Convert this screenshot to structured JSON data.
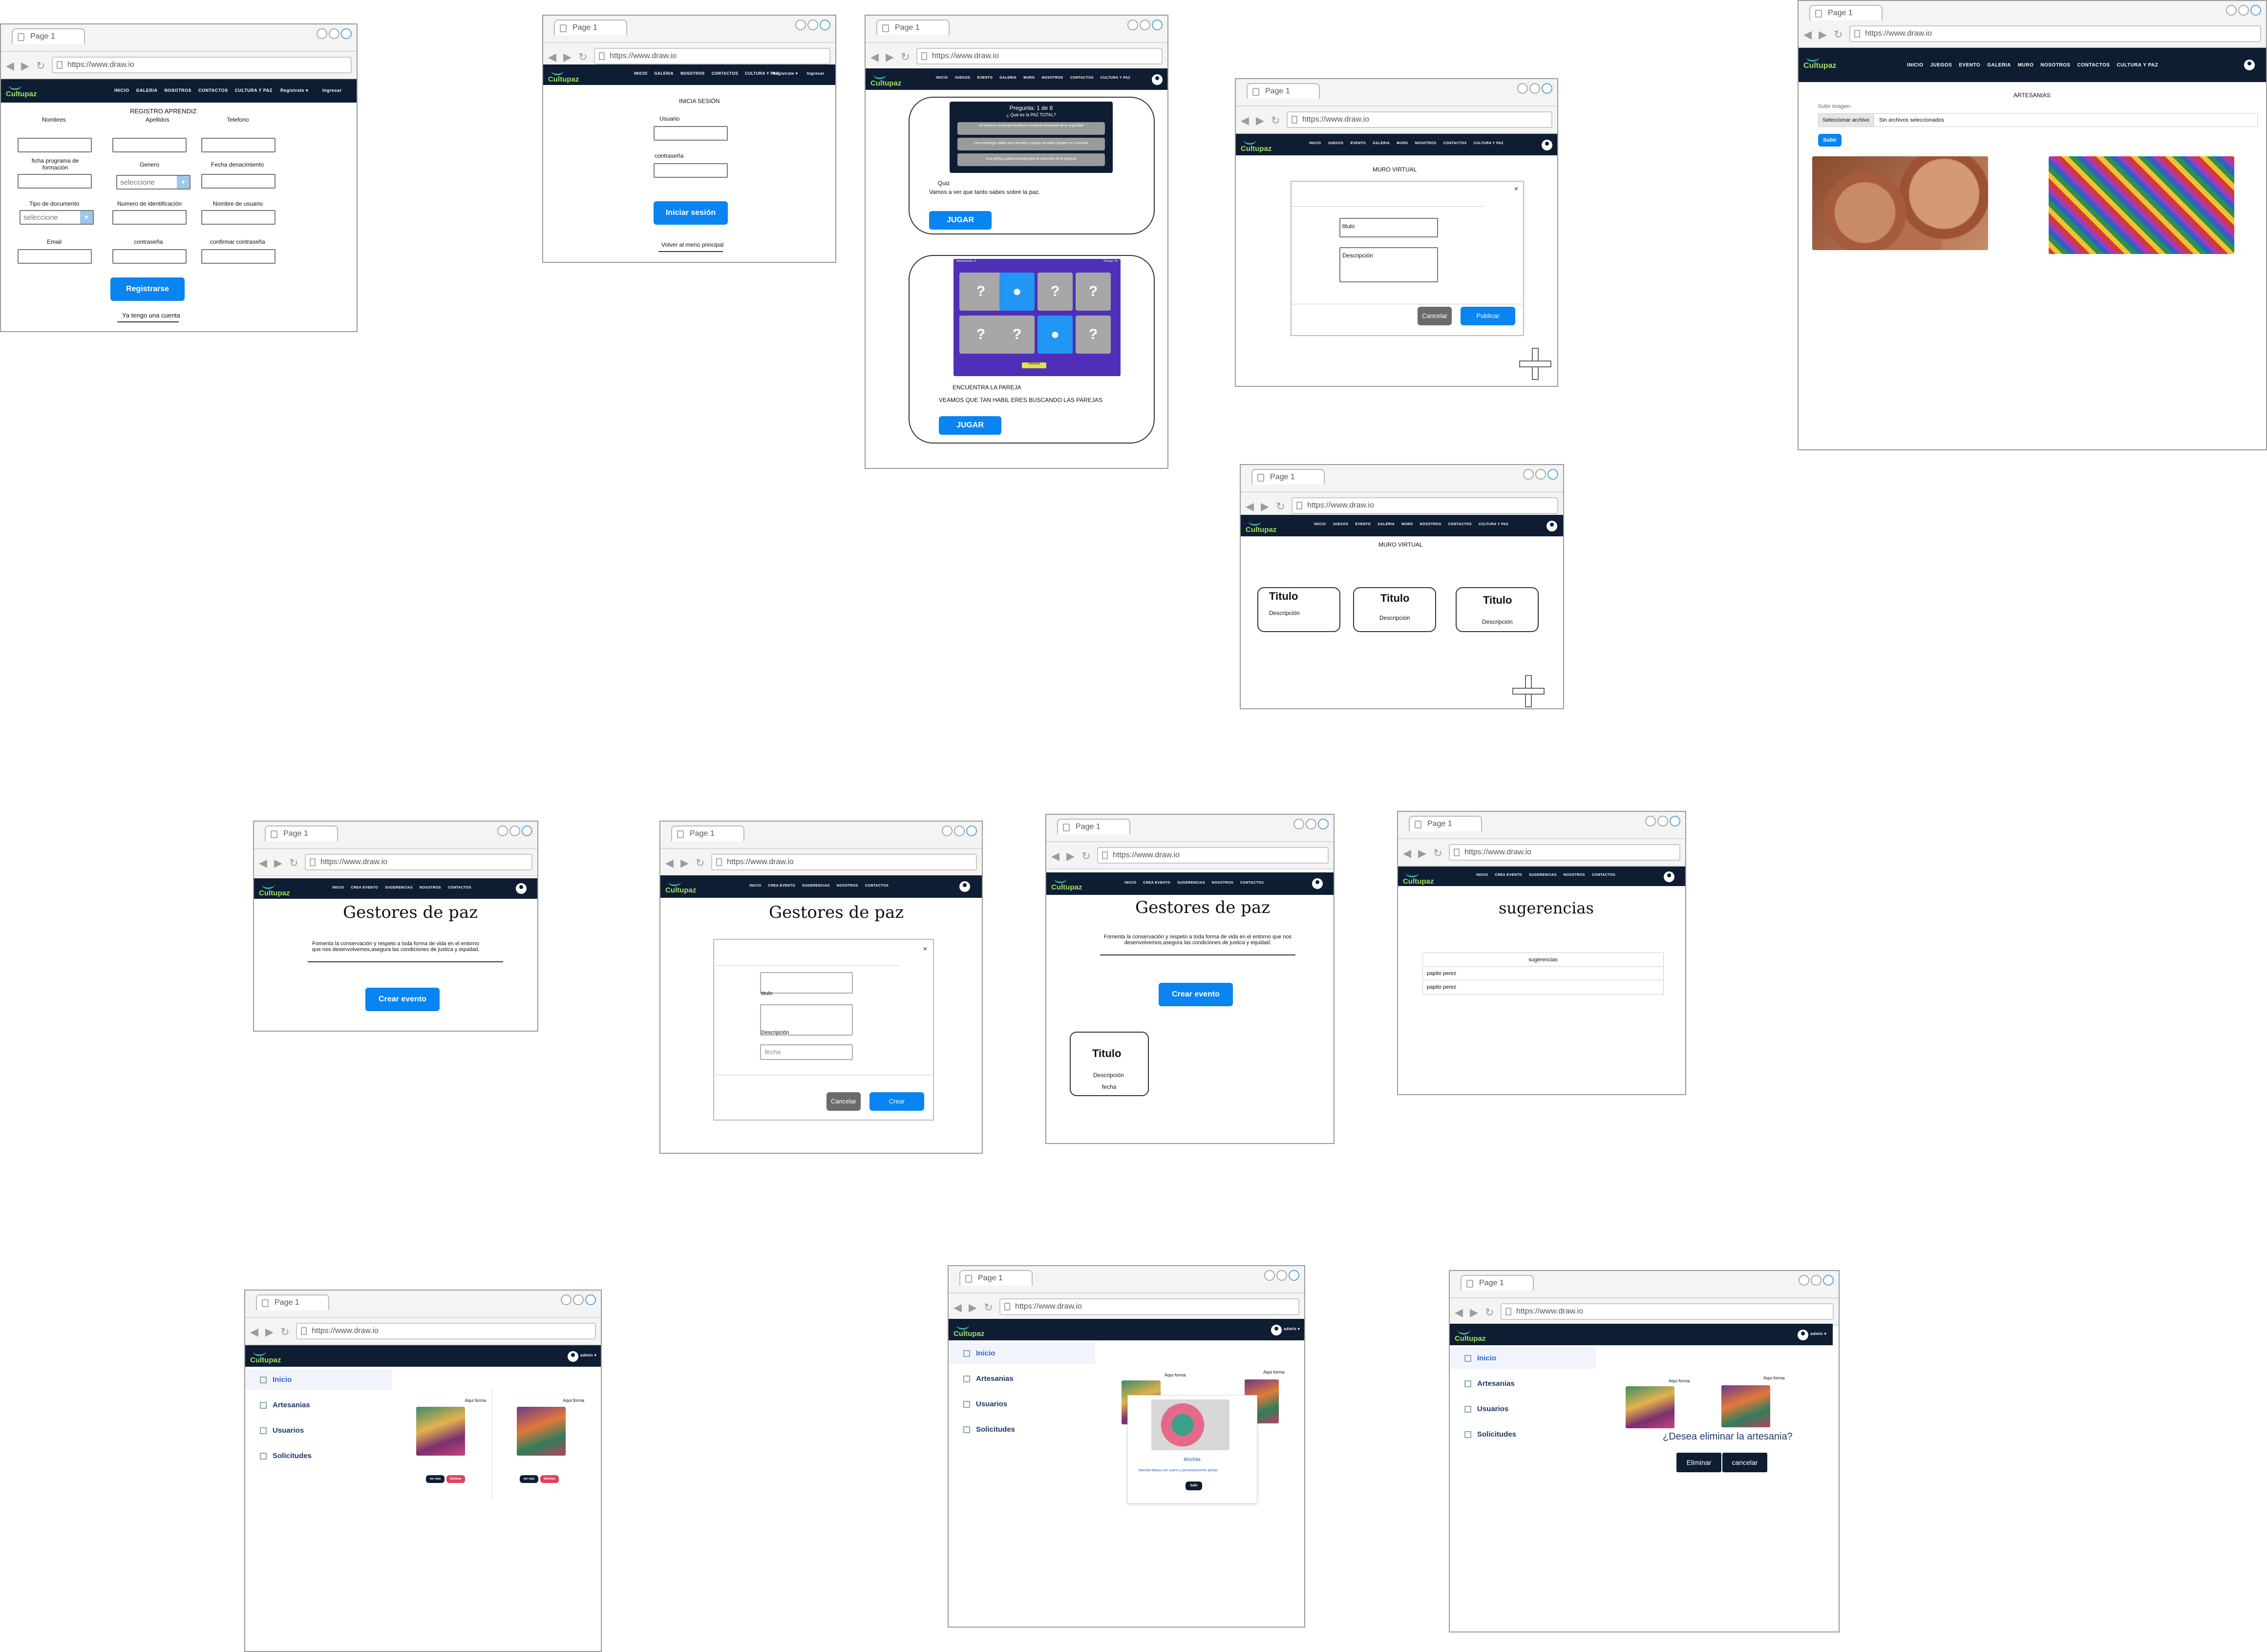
{
  "browser": {
    "tab_label": "Page 1",
    "url": "https://www.draw.io",
    "url_alt": "https://www.draw.io "
  },
  "brand": {
    "logo": "Cultupaz",
    "colors": {
      "nav": "#0f1d33",
      "primary": "#0a84f0",
      "logo": "#9be05c"
    }
  },
  "nav_public": [
    "INICIO",
    "GALERIA",
    "NOSOTROS",
    "CONTACTOS",
    "CULTURA Y PAZ"
  ],
  "nav_register": "Registrate ▾",
  "nav_login": "Ingresar",
  "nav_games": [
    "INICIO",
    "JUEGOS",
    "EVENTO",
    "GALERIA",
    "MURO",
    "NOSOTROS",
    "CONTACTOS",
    "CULTURA Y PAZ"
  ],
  "nav_gestores": [
    "INICIO",
    "CREA EVENTO",
    "SUGERENCIAS",
    "NOSOTROS",
    "CONTACTOS"
  ],
  "register": {
    "title": "REGISTRO APRENDIZ",
    "labels": [
      "Nombres",
      "Apellidos",
      "Telefono",
      "ficha programa de formación",
      "Genero",
      "Fecha denacimiento",
      "Tipo de documento",
      "Numero de identificación",
      "Nombre de usuario",
      "Email",
      "contraseña",
      "confirmar contraseña"
    ],
    "select_placeholder": "seleccione",
    "submit": "Registrarse",
    "have_account": "Ya tengo una cuenta"
  },
  "login": {
    "title": "INICIA SESIÓN",
    "user_label": "Usuario",
    "pass_label": "contraseña",
    "submit": "Iniciar sesión",
    "back": "Volver al menú principal"
  },
  "games": {
    "quiz_question_header": "Pregunta: 1 de 8",
    "quiz_question": "¿ Qué es la PAZ TOTAL?",
    "quiz_options": [
      "Un proceso social que facilita la constante búsqueda de la seguridad",
      "Una estrategia militar para derrotar a grupos armados ilegales en Colombia",
      "Una política gubernamental para la reducción de la pobreza"
    ],
    "quiz_caption": "Quiz",
    "quiz_desc": "Vamos a ver que tanto sabes sobre la paz.",
    "play": "JUGAR",
    "memory_title": "ENCUENTRA LA PAREJA",
    "memory_desc": "VEAMOS QUE TAN HABIL ERES BUSCANDO LAS PAREJAS",
    "memory_cards": [
      "?",
      "●",
      "?",
      "?",
      "?",
      "?",
      "●",
      "?"
    ],
    "memory_header_left": "Movimientos: 0",
    "memory_header_right": "Tiempo: 0s",
    "memory_reset": "Reiniciar"
  },
  "muro": {
    "title": "MURO VIRTUAL",
    "close": "×",
    "titulo_placeholder": "titulo",
    "descripcion_placeholder": "Descripción",
    "cancel": "Cancelar",
    "publish": "Publicar",
    "cards": [
      {
        "title": "Titulo",
        "desc": "Descripción"
      },
      {
        "title": "Titulo",
        "desc": "Descripción"
      },
      {
        "title": "Titulo",
        "desc": "Descripción"
      }
    ]
  },
  "artesanias": {
    "title": "ARTESANIAS",
    "upload_label": "Subir imagen:",
    "choose_file": "Seleccionar archivo",
    "no_file": "Sin archivos seleccionados",
    "submit": "Subir"
  },
  "gestores": {
    "title": "Gestores de paz",
    "desc": "Fomenta la conservación y respeto a toda forma de vida en el entorno que nos desenvolvemos,asegura las condiciones de justica y equidad.",
    "create": "Crear evento",
    "form_titulo": "titulo",
    "form_desc": "Descripción",
    "form_fecha": "fecha",
    "form_cancel": "Cancelar",
    "form_create": "Crear",
    "event_card": {
      "title": "Titulo",
      "desc": "Descripción",
      "date": "fecha"
    }
  },
  "sugerencias": {
    "title": "sugerencias",
    "header": "sugerencias",
    "rows": [
      "papito perez",
      "papito perez"
    ]
  },
  "admin": {
    "user": "admin ▾",
    "menu": [
      "Inicio",
      "Artesanias",
      "Usuarios",
      "Solicitudes"
    ],
    "items": [
      {
        "name": "Aqui forma",
        "view": "ver más",
        "delete": "Eliminar"
      },
      {
        "name": "Aqui forma",
        "view": "ver más",
        "delete": "Eliminar"
      }
    ],
    "detail_name": "Mochila",
    "detail_desc": "Mochila Wayuu con sueno y personas/correo piezas",
    "detail_close": "Salir",
    "delete_question": "¿Desea eliminar la artesania?",
    "delete_confirm": "Eliminar",
    "delete_cancel": "cancelar"
  }
}
